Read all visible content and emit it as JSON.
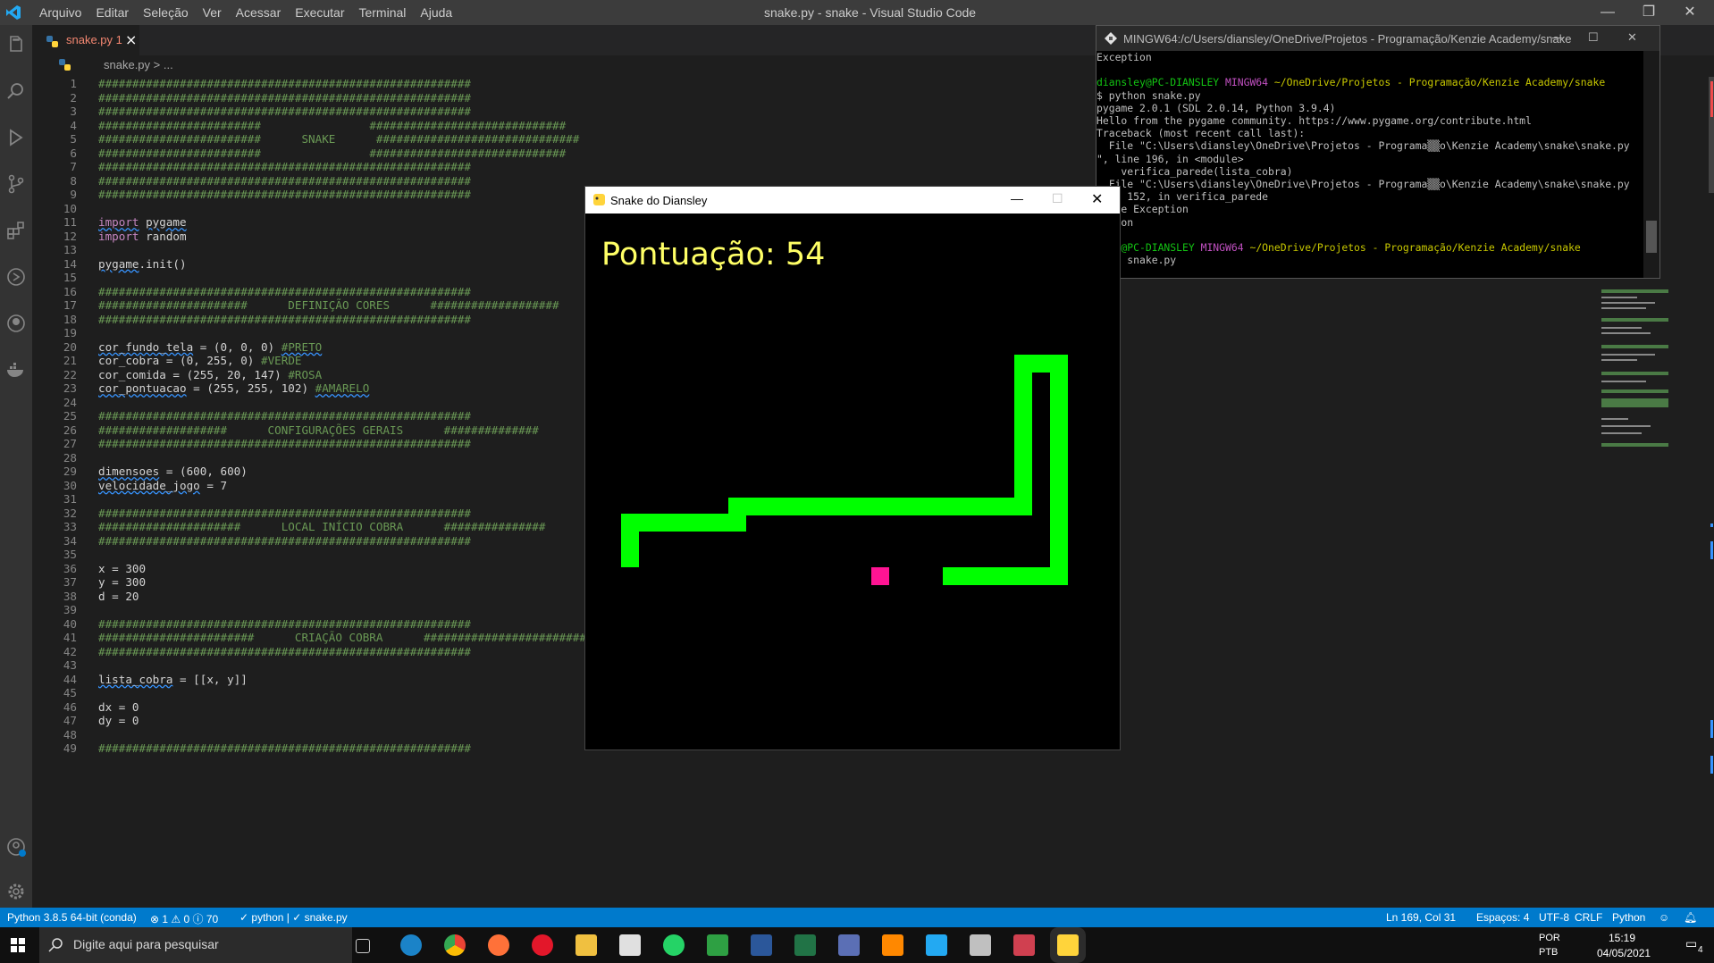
{
  "titlebar": {
    "menu": [
      "Arquivo",
      "Editar",
      "Seleção",
      "Ver",
      "Acessar",
      "Executar",
      "Terminal",
      "Ajuda"
    ],
    "title": "snake.py - snake - Visual Studio Code"
  },
  "editor": {
    "tab_label": "snake.py 1",
    "breadcrumb": "snake.py > ...",
    "line_numbers": [
      "1",
      "2",
      "3",
      "4",
      "5",
      "6",
      "7",
      "8",
      "9",
      "10",
      "11",
      "12",
      "13",
      "14",
      "15",
      "16",
      "17",
      "18",
      "19",
      "20",
      "21",
      "22",
      "23",
      "24",
      "25",
      "26",
      "27",
      "28",
      "29",
      "30",
      "31",
      "32",
      "33",
      "34",
      "35",
      "36",
      "37",
      "38",
      "39",
      "40",
      "41",
      "42",
      "43",
      "44",
      "45",
      "46",
      "47",
      "48",
      "49"
    ],
    "code": {
      "hash_full": "#######################################################",
      "snake_banner": "########################      SNAKE      ##############################",
      "banner_edge": "########################",
      "import_pygame_kw": "import",
      "import_pygame_mod": "pygame",
      "import_random_mod": "random",
      "pygame_init_mod": "pygame",
      "pygame_init_rest": ".init()",
      "def_cores_banner": "######################      DEFINIÇÃO CORES      ###################",
      "cor_fundo_name": "cor_fundo_tela",
      "cor_fundo_rest": " = (0, 0, 0) ",
      "cor_fundo_comment": "#PRETO",
      "cor_cobra": "cor_cobra = (0, 255, 0) ",
      "cor_cobra_comment": "#VERDE",
      "cor_comida": "cor_comida = (255, 20, 147) ",
      "cor_comida_comment": "#ROSA",
      "cor_pont_name": "cor_pontuacao",
      "cor_pont_rest": " = (255, 255, 102) ",
      "cor_pont_comment": "#AMARELO",
      "config_banner": "###################      CONFIGURAÇÕES GERAIS      ##############",
      "dimensoes_name": "dimensoes",
      "dimensoes_rest": " = (600, 600)",
      "velocidade_name": "velocidade_jogo",
      "velocidade_rest": " = 7",
      "local_banner": "#####################      LOCAL INÍCIO COBRA      ###############",
      "x_line": "x = 300",
      "y_line": "y = 300",
      "d_line": "d = 20",
      "criacao_banner": "#######################      CRIAÇÃO COBRA      ########################",
      "lista_name": "lista_cobra",
      "lista_rest": " = [[x, y]]",
      "dx_line": "dx = 0",
      "dy_line": "dy = 0"
    }
  },
  "statusbar": {
    "interpreter": "Python 3.8.5 64-bit (conda)",
    "problems": "⊗ 1 ⚠ 0 ⓘ 70",
    "checks": "✓ python | ✓ snake.py",
    "position": "Ln 169, Col 31",
    "spaces": "Espaços: 4",
    "encoding": "UTF-8",
    "eol": "CRLF",
    "language": "Python"
  },
  "terminal": {
    "title": "MINGW64:/c/Users/diansley/OneDrive/Projetos - Programação/Kenzie Academy/snake",
    "lines": {
      "l1": "Exception",
      "prompt_user": "diansley@PC-DIANSLEY",
      "prompt_env": "MINGW64",
      "prompt_path": "~/OneDrive/Projetos - Programação/Kenzie Academy/snake",
      "cmd": "$ python snake.py",
      "pygame": "pygame 2.0.1 (SDL 2.0.14, Python 3.9.4)",
      "hello": "Hello from the pygame community. https://www.pygame.org/contribute.html",
      "traceback": "Traceback (most recent call last):",
      "file1": "  File \"C:\\Users\\diansley\\OneDrive\\Projetos - Programa▒▒o\\Kenzie Academy\\snake\\snake.py",
      "file1b": "\", line 196, in <module>",
      "call1": "    verifica_parede(lista_cobra)",
      "file2": "  File \"C:\\Users\\diansley\\OneDrive\\Projetos - Programa▒▒o\\Kenzie Academy\\snake\\snake.py",
      "file2b": "line 152, in verifica_parede",
      "raise": "raise Exception",
      "eption": "eption",
      "prompt2_user": "sley@PC-DIANSLEY",
      "cmd2": "thon snake.py"
    }
  },
  "game": {
    "title": "Snake do Diansley",
    "score": "Pontuação: 54",
    "colors": {
      "snake": "#00ff00",
      "food": "#ff1493",
      "score": "#ffff66",
      "bg": "#000000"
    }
  },
  "taskbar": {
    "search_placeholder": "Digite aqui para pesquisar",
    "lang": "POR",
    "layout": "PTB",
    "time": "15:19",
    "date": "04/05/2021",
    "notif_count": "4"
  }
}
